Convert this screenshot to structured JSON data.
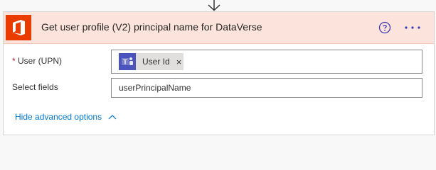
{
  "action": {
    "title": "Get user profile (V2) principal name for DataVerse",
    "icons": {
      "app": "office-365-icon",
      "help": "help-icon",
      "more": "more-options-icon"
    },
    "colors": {
      "header_bg": "#fce4dc",
      "app_tile": "#eb3c00",
      "link": "#0078d4",
      "required": "#a4262c"
    }
  },
  "fields": {
    "user": {
      "required_mark": "*",
      "label": "User (UPN)",
      "token": {
        "icon": "teams-icon",
        "label": "User Id",
        "remove": "×"
      }
    },
    "select": {
      "label": "Select fields",
      "value": "userPrincipalName"
    }
  },
  "advanced": {
    "label": "Hide advanced options",
    "icon": "chevron-up-icon"
  }
}
